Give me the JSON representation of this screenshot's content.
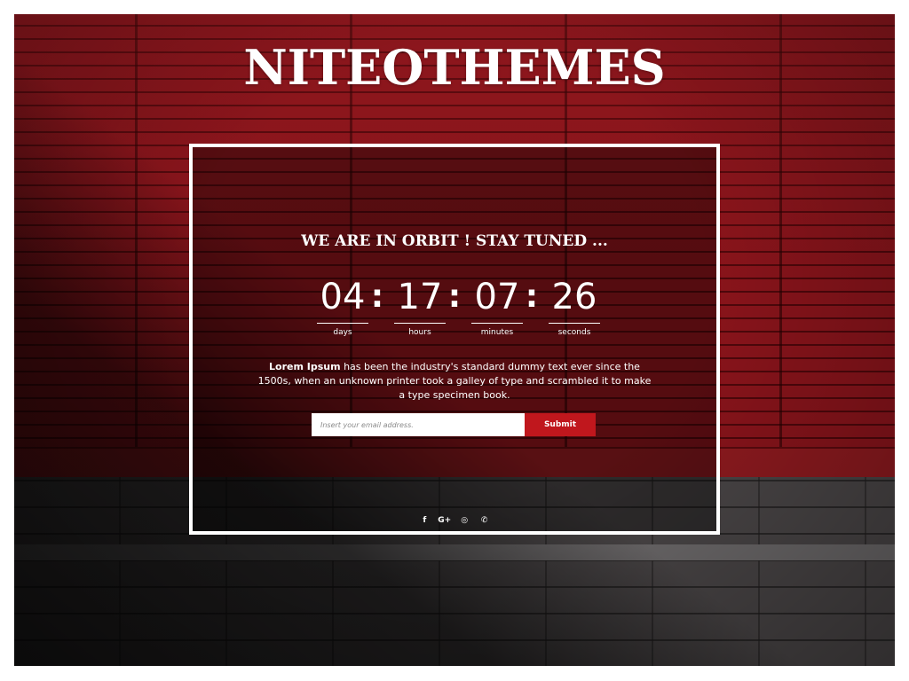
{
  "site": {
    "brand": "NITEOTHEMES"
  },
  "hero": {
    "tagline": "WE ARE IN ORBIT ! STAY TUNED ...",
    "countdown": [
      {
        "value": "04",
        "label": "days"
      },
      {
        "value": "17",
        "label": "hours"
      },
      {
        "value": "07",
        "label": "minutes"
      },
      {
        "value": "26",
        "label": "seconds"
      }
    ],
    "separator": ":",
    "description_bold": "Lorem Ipsum",
    "description_rest": " has been the industry's standard dummy text ever since the 1500s, when an unknown printer took a galley of type and scrambled it to make a type specimen book."
  },
  "signup": {
    "email_placeholder": "Insert your email address.",
    "submit_label": "Submit"
  },
  "social": [
    {
      "icon": "facebook-icon",
      "glyph": "f"
    },
    {
      "icon": "google-plus-icon",
      "glyph": "G+"
    },
    {
      "icon": "whatsapp-icon",
      "glyph": "◎"
    },
    {
      "icon": "phone-icon",
      "glyph": "✆"
    }
  ],
  "colors": {
    "accent": "#c0171d",
    "wall": "#7c1117"
  }
}
